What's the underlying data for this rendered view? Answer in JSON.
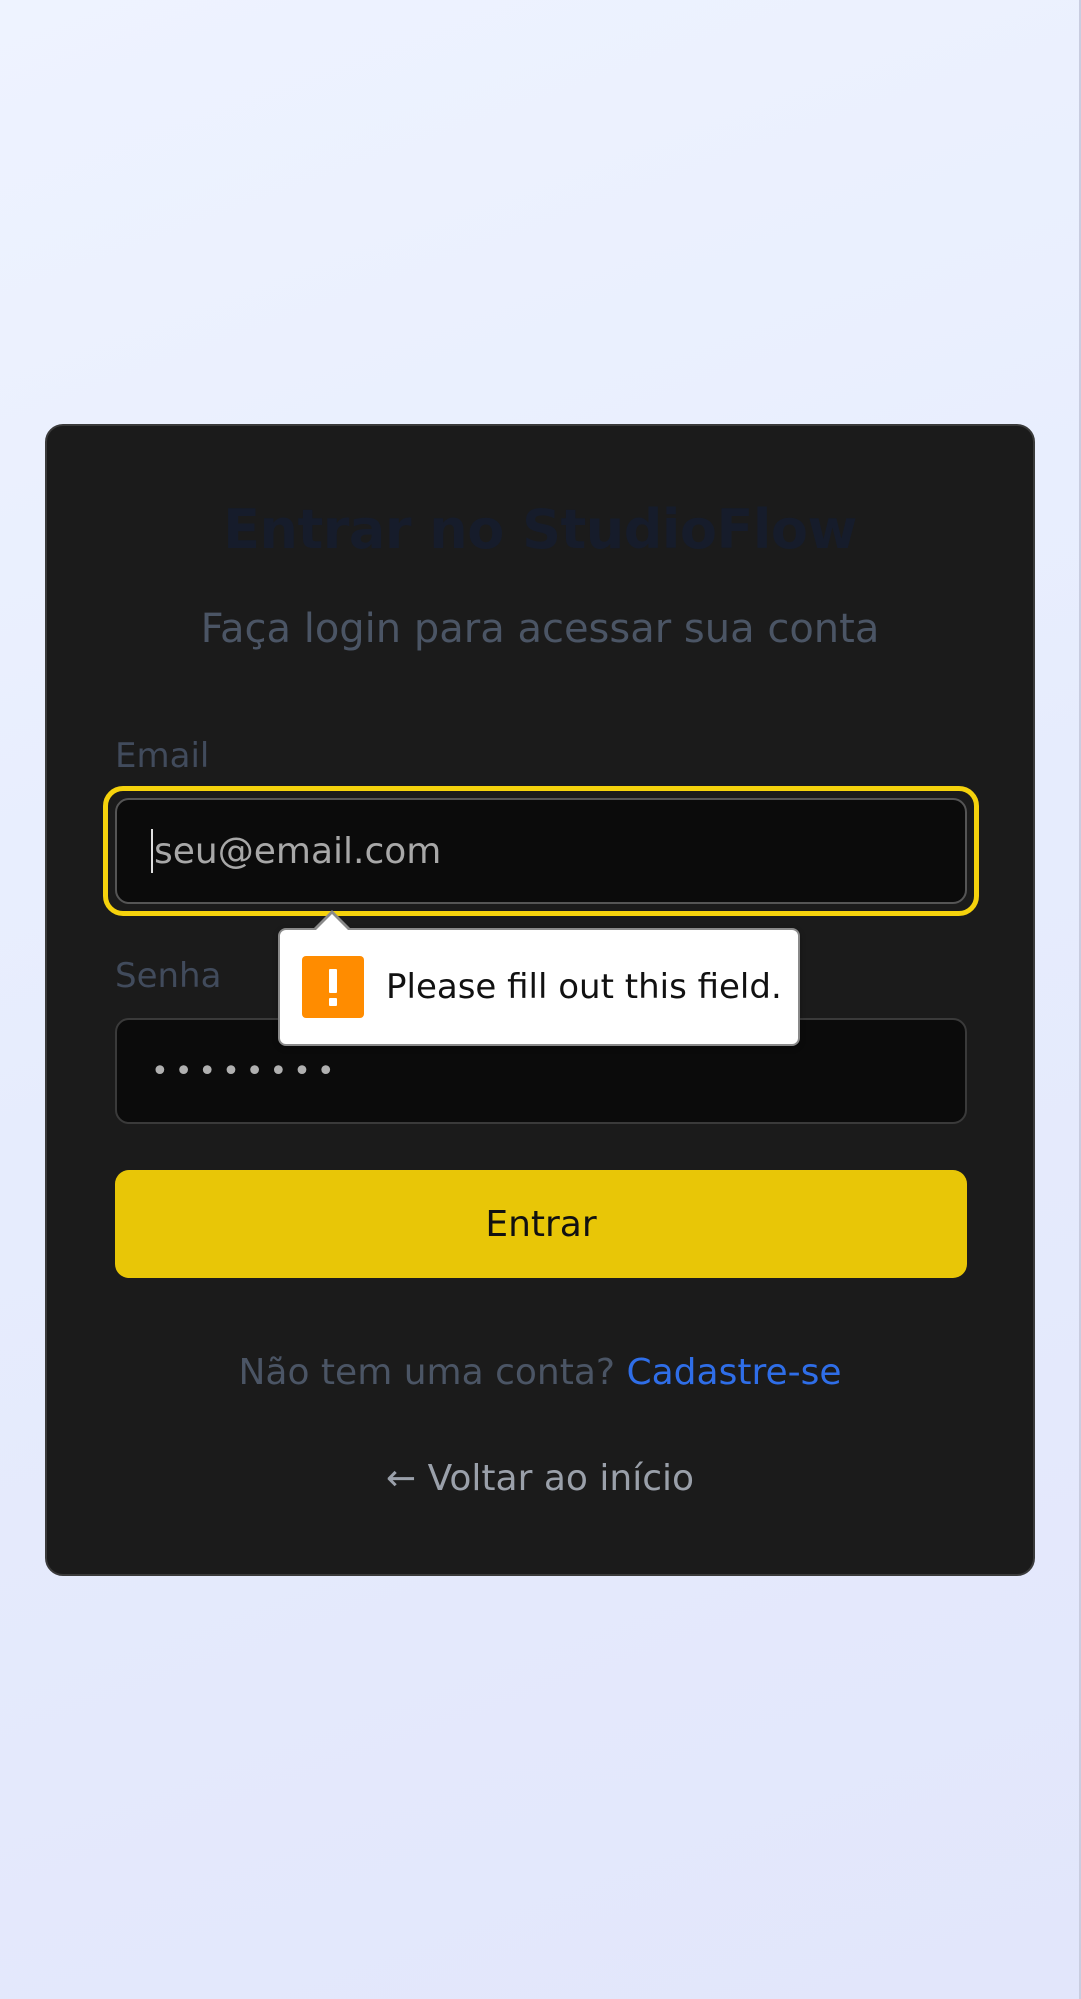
{
  "login": {
    "title": "Entrar no StudioFlow",
    "subtitle": "Faça login para acessar sua conta",
    "email_label": "Email",
    "email_placeholder": "seu@email.com",
    "email_value": "",
    "password_label": "Senha",
    "password_value": "••••••••",
    "submit_label": "Entrar",
    "signup_prompt": "Não tem uma conta?",
    "signup_link": "Cadastre-se",
    "back_link": "← Voltar ao início"
  },
  "validation": {
    "message": "Please fill out this field.",
    "icon": "warning-icon"
  },
  "colors": {
    "accent": "#e8c607",
    "focus_ring": "#f5d20c",
    "link": "#2f6ee8",
    "card_bg": "#1b1b1b",
    "warning": "#ff8c00"
  }
}
